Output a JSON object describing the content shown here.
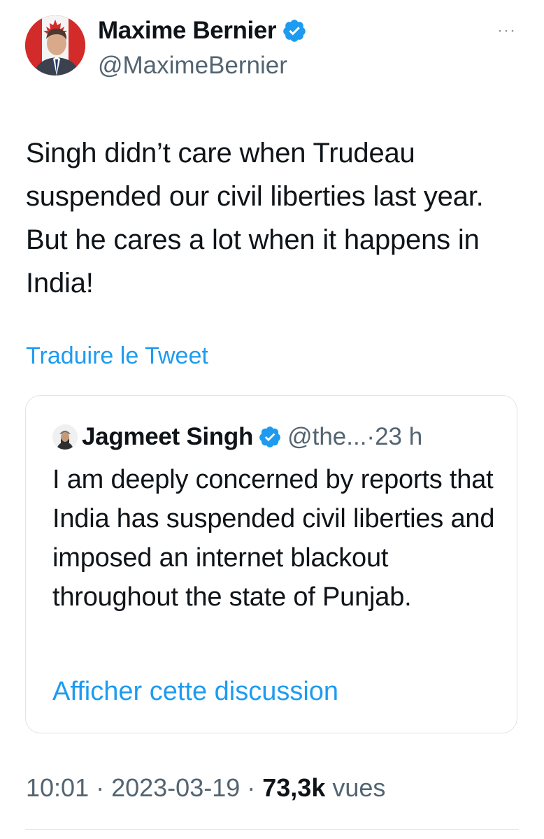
{
  "author": {
    "name": "Maxime Bernier",
    "handle": "@MaximeBernier",
    "verified_icon": "verified-badge-icon",
    "more_icon": "more-options-icon",
    "more_glyph": "···"
  },
  "tweet": {
    "text": "Singh didn’t care when Trudeau suspended our civil liberties last year. But he cares a lot when it happens in India!",
    "translate_label": "Traduire le Tweet"
  },
  "quoted_tweet": {
    "name": "Jagmeet Singh",
    "handle": "@the...",
    "separator": "·",
    "time": "23 h",
    "text": "I am deeply concerned by reports that India has suspended civil liberties and imposed an internet blackout throughout the state of Punjab.",
    "show_thread_label": "Afficher cette discussion"
  },
  "meta": {
    "time": "10:01",
    "sep1": " · ",
    "date": "2023-03-19",
    "sep2": " · ",
    "views_count": "73,3k",
    "views_label": " vues"
  },
  "colors": {
    "accent": "#1d9bf0",
    "text": "#0f1419",
    "secondary": "#536471"
  }
}
